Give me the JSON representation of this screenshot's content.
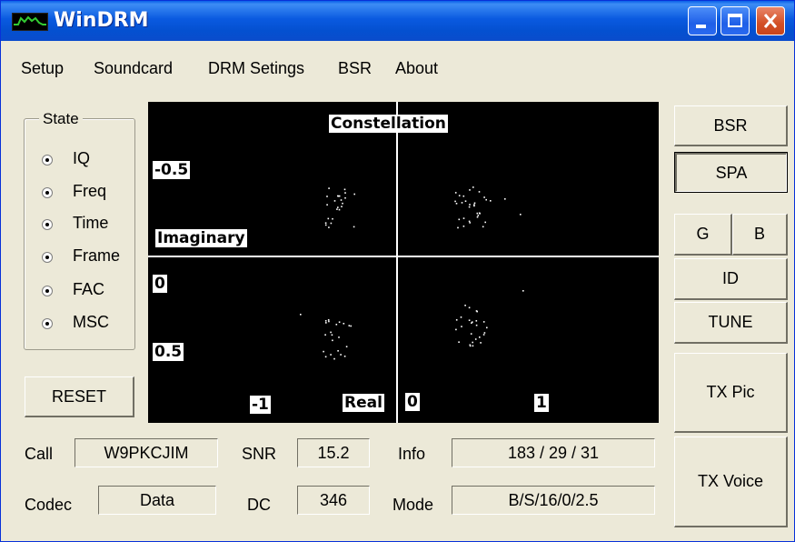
{
  "window": {
    "title": "WinDRM",
    "icon": "app-waveform-icon"
  },
  "title_buttons": [
    "minimize-icon",
    "maximize-icon",
    "close-icon"
  ],
  "menu": [
    "Setup",
    "Soundcard",
    "DRM Setings",
    "BSR",
    "About"
  ],
  "state_group": {
    "title": "State",
    "options": [
      "IQ",
      "Freq",
      "Time",
      "Frame",
      "FAC",
      "MSC"
    ],
    "selected": [
      "IQ",
      "Freq",
      "Time",
      "Frame",
      "FAC",
      "MSC"
    ]
  },
  "reset_button": "RESET",
  "plot": {
    "title": "Constellation",
    "y_label": "Imaginary",
    "x_label": "Real",
    "y_ticks": [
      "-0.5",
      "0",
      "0.5"
    ],
    "x_ticks": [
      "-1",
      "0",
      "1"
    ]
  },
  "right_buttons": {
    "bsr": "BSR",
    "spa": "SPA",
    "g": "G",
    "b": "B",
    "id": "ID",
    "tune": "TUNE",
    "tx_pic": "TX Pic",
    "tx_voice": "TX Voice"
  },
  "fields": {
    "call_label": "Call",
    "call_value": "W9PKCJIM",
    "codec_label": "Codec",
    "codec_value": "Data",
    "snr_label": "SNR",
    "snr_value": "15.2",
    "dc_label": "DC",
    "dc_value": "346",
    "info_label": "Info",
    "info_value": "183 / 29 / 31",
    "mode_label": "Mode",
    "mode_value": "B/S/16/0/2.5"
  },
  "colors": {
    "title_bar": "#0a5ae0",
    "plot_bg": "#000000",
    "axis": "#ffffff",
    "points": "#ffffff",
    "window_bg": "#ece9d8"
  }
}
